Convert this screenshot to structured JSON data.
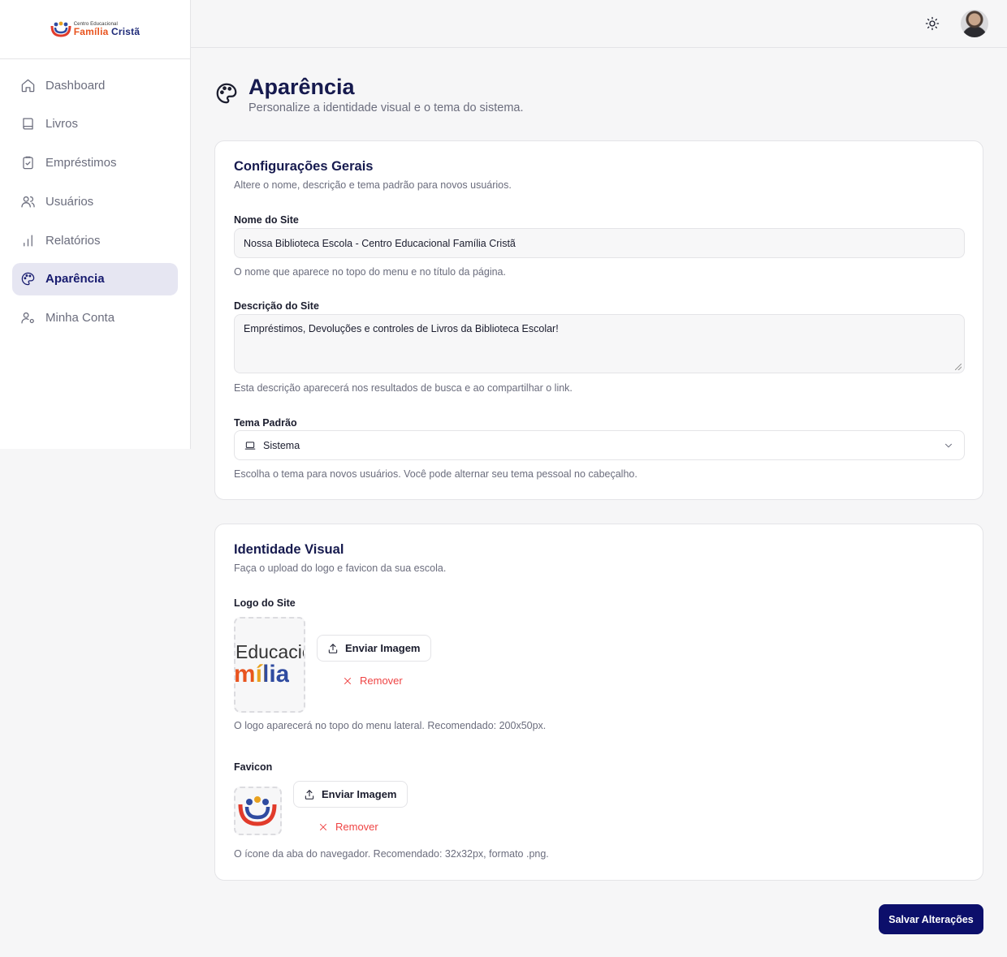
{
  "brand": {
    "logo_small": "Centro Educacional",
    "logo_big_1": "Família",
    "logo_big_2": "Cristã"
  },
  "sidebar": {
    "items": [
      {
        "label": "Dashboard",
        "icon": "home-icon"
      },
      {
        "label": "Livros",
        "icon": "book-icon"
      },
      {
        "label": "Empréstimos",
        "icon": "clipboard-check-icon"
      },
      {
        "label": "Usuários",
        "icon": "users-icon"
      },
      {
        "label": "Relatórios",
        "icon": "bar-chart-icon"
      },
      {
        "label": "Aparência",
        "icon": "palette-icon",
        "active": true
      },
      {
        "label": "Minha Conta",
        "icon": "user-cog-icon"
      }
    ]
  },
  "page": {
    "title": "Aparência",
    "subtitle": "Personalize a identidade visual e o tema do sistema."
  },
  "general": {
    "title": "Configurações Gerais",
    "desc": "Altere o nome, descrição e tema padrão para novos usuários.",
    "site_name_label": "Nome do Site",
    "site_name_value": "Nossa Biblioteca Escola - Centro Educacional Família Cristã",
    "site_name_help": "O nome que aparece no topo do menu e no título da página.",
    "site_desc_label": "Descrição do Site",
    "site_desc_value": "Empréstimos, Devoluções e controles de Livros da Biblioteca Escolar!",
    "site_desc_help": "Esta descrição aparecerá nos resultados de busca e ao compartilhar o link.",
    "theme_label": "Tema Padrão",
    "theme_value": "Sistema",
    "theme_help": "Escolha o tema para novos usuários. Você pode alternar seu tema pessoal no cabeçalho."
  },
  "visual": {
    "title": "Identidade Visual",
    "desc": "Faça o upload do logo e favicon da sua escola.",
    "logo_label": "Logo do Site",
    "logo_preview_line1": "Educacio",
    "logo_preview_line2": "mília",
    "logo_help": "O logo aparecerá no topo do menu lateral. Recomendado: 200x50px.",
    "favicon_label": "Favicon",
    "favicon_help": "O ícone da aba do navegador. Recomendado: 32x32px, formato .png.",
    "upload_label": "Enviar Imagem",
    "remove_label": "Remover"
  },
  "actions": {
    "save_label": "Salvar Alterações"
  },
  "colors": {
    "primary": "#0c0f6b",
    "active_bg": "#e6e6f2",
    "danger": "#ef4444"
  }
}
